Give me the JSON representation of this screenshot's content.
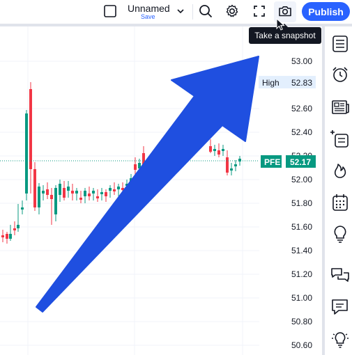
{
  "toolbar": {
    "layout_name": "Unnamed",
    "save_label": "Save",
    "publish_label": "Publish",
    "tooltip": "Take a snapshot"
  },
  "price_scale": {
    "ticks": [
      "53.00",
      "52.60",
      "52.40",
      "52.20",
      "52.00",
      "51.80",
      "51.60",
      "51.40",
      "51.20",
      "51.00",
      "50.80",
      "50.60"
    ],
    "high_label": "High",
    "high_value": "52.83",
    "symbol": "PFE",
    "last_price": "52.17"
  },
  "colors": {
    "up": "#089981",
    "down": "#f23645",
    "accent": "#2962ff",
    "arrow": "#1f4fe0"
  },
  "icons": {
    "sidebar": [
      "watchlist-icon",
      "alert-clock-icon",
      "news-icon",
      "add-list-icon",
      "hotlist-fire-icon",
      "calendar-icon",
      "ideas-bulb-icon",
      "chats-icon",
      "chat-icon",
      "help-bulb-icon"
    ]
  }
}
